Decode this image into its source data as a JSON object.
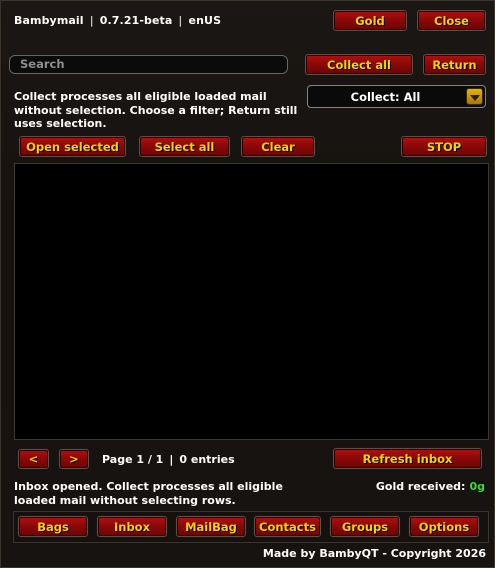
{
  "header": {
    "app_name": "Bambymail",
    "version": "0.7.21-beta",
    "locale": "enUS",
    "gold_button": "Gold",
    "close_button": "Close"
  },
  "search": {
    "placeholder": "Search",
    "value": ""
  },
  "actions": {
    "collect_all": "Collect all",
    "return": "Return",
    "info_text": "Collect processes all eligible loaded mail without selection. Choose a filter; Return still uses selection.",
    "collect_filter": "Collect: All"
  },
  "selection": {
    "open_selected": "Open selected",
    "select_all": "Select all",
    "clear": "Clear",
    "stop": "STOP"
  },
  "mail_list": {
    "rows": []
  },
  "pager": {
    "prev": "<",
    "next": ">",
    "page_label": "Page 1 / 1",
    "entries_label": "0 entries",
    "refresh": "Refresh inbox"
  },
  "status": {
    "message": "Inbox opened. Collect processes all eligible loaded mail without selecting rows.",
    "gold_received_label": "Gold received:",
    "gold_received_value": "0g"
  },
  "tabs": [
    {
      "label": "Bags"
    },
    {
      "label": "Inbox"
    },
    {
      "label": "MailBag"
    },
    {
      "label": "Contacts"
    },
    {
      "label": "Groups"
    },
    {
      "label": "Options"
    }
  ],
  "footer": {
    "credit": "Made by BambyQT - Copyright 2026"
  },
  "colors": {
    "button_red": "#8e0808",
    "button_text_gold": "#ffd100",
    "gold_value_green": "#33dd33",
    "background": "#15120f"
  }
}
